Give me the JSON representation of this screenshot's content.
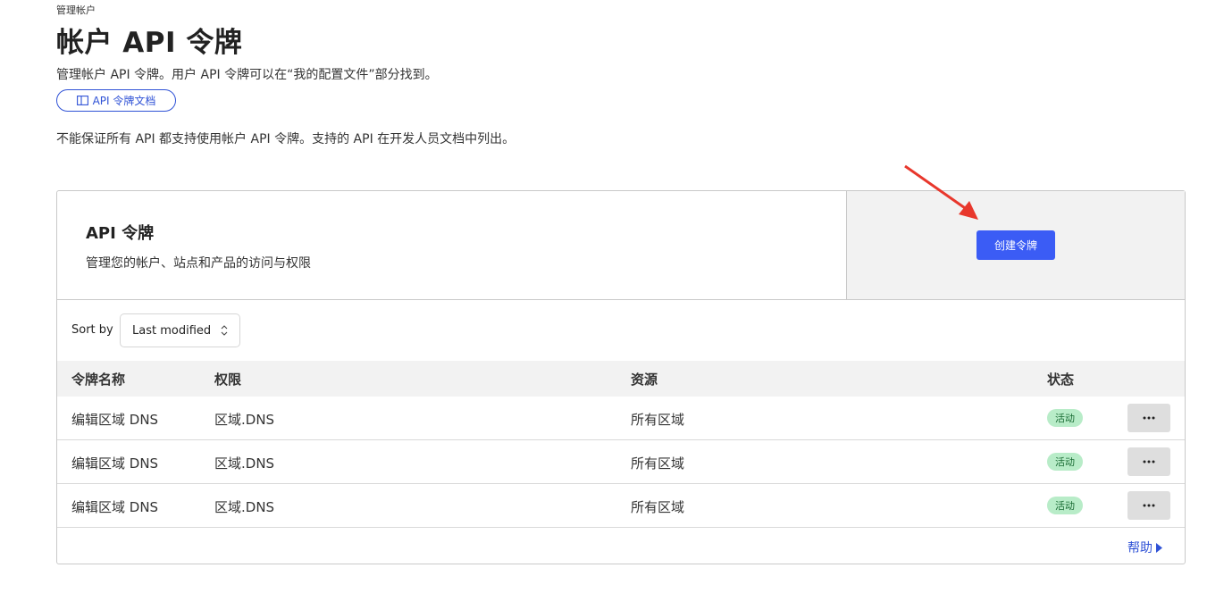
{
  "breadcrumb": "管理帐户",
  "page_title": "帐户 API 令牌",
  "subtitle": "管理帐户 API 令牌。用户 API 令牌可以在“我的配置文件”部分找到。",
  "doc_link": {
    "label": "API 令牌文档",
    "icon": "book-icon"
  },
  "notice": "不能保证所有 API 都支持使用帐户 API 令牌。支持的 API 在开发人员文档中列出。",
  "tokens_card": {
    "title": "API 令牌",
    "subtitle": "管理您的帐户、站点和产品的访问与权限",
    "create_button": "创建令牌"
  },
  "sort": {
    "label": "Sort by",
    "value": "Last modified"
  },
  "table": {
    "headers": {
      "name": "令牌名称",
      "permissions": "权限",
      "resources": "资源",
      "status": "状态"
    },
    "rows": [
      {
        "name": "编辑区域 DNS",
        "permissions": "区域.DNS",
        "resources": "所有区域",
        "status": "活动"
      },
      {
        "name": "编辑区域 DNS",
        "permissions": "区域.DNS",
        "resources": "所有区域",
        "status": "活动"
      },
      {
        "name": "编辑区域 DNS",
        "permissions": "区域.DNS",
        "resources": "所有区域",
        "status": "活动"
      }
    ]
  },
  "help_link": "帮助",
  "colors": {
    "accent": "#3b5cf5",
    "link": "#2f52d6",
    "status_bg": "#b8ecc8",
    "status_text": "#196b33",
    "annotation_arrow": "#e8372c"
  }
}
